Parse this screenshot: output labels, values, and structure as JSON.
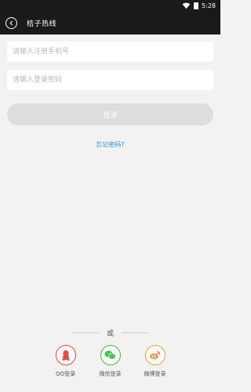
{
  "status_bar": {
    "time": "5:28"
  },
  "app_bar": {
    "title": "桔子热线"
  },
  "form": {
    "phone_placeholder": "请输入注册手机号",
    "password_placeholder": "请输入登录密码",
    "login_label": "登录",
    "forgot_label": "忘记密码?"
  },
  "social": {
    "divider_text": "或",
    "items": [
      {
        "label": "QQ登录",
        "icon": "qq-penguin-icon",
        "color": "#e04a4a"
      },
      {
        "label": "微信登录",
        "icon": "wechat-icon",
        "color": "#3fbf46"
      },
      {
        "label": "微博登录",
        "icon": "weibo-icon",
        "color": "#e6a534"
      }
    ]
  },
  "colors": {
    "bar_bg": "#1a1a1a",
    "page_bg": "#f2f2f2",
    "link": "#2b8fd8",
    "button_disabled": "#dddddd"
  }
}
